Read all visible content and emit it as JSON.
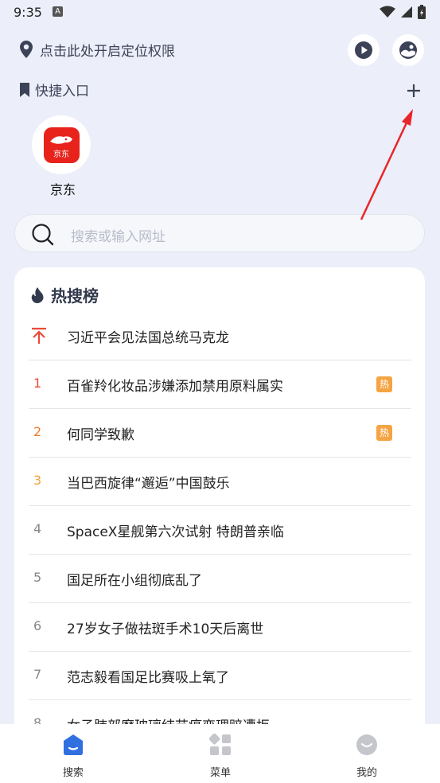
{
  "status_bar": {
    "time": "9:35",
    "notif_letter": "A"
  },
  "location": {
    "text": "点击此处开启定位权限"
  },
  "quick_access": {
    "title": "快捷入口",
    "add_symbol": "+",
    "apps": [
      {
        "name": "京东",
        "icon_text": "京东",
        "color": "#e8231b"
      }
    ]
  },
  "search": {
    "placeholder": "搜索或输入网址"
  },
  "hot": {
    "title": "热搜榜",
    "badge_label": "热",
    "items": [
      {
        "rank": "",
        "text": "习近平会见法国总统马克龙",
        "pinned": true
      },
      {
        "rank": "1",
        "text": "百雀羚化妆品涉嫌添加禁用原料属实",
        "hot": true
      },
      {
        "rank": "2",
        "text": "何同学致歉",
        "hot": true
      },
      {
        "rank": "3",
        "text": "当巴西旋律“邂逅”中国鼓乐"
      },
      {
        "rank": "4",
        "text": "SpaceX星舰第六次试射 特朗普亲临"
      },
      {
        "rank": "5",
        "text": "国足所在小组彻底乱了"
      },
      {
        "rank": "6",
        "text": "27岁女子做祛斑手术10天后离世"
      },
      {
        "rank": "7",
        "text": "范志毅看国足比赛吸上氧了"
      },
      {
        "rank": "8",
        "text": "女子肺部磨玻璃结节癌变理赔遭拒"
      }
    ]
  },
  "bottom_nav": [
    {
      "label": "搜索",
      "active": true
    },
    {
      "label": "菜单"
    },
    {
      "label": "我的"
    }
  ],
  "colors": {
    "accent": "#2f6fe0",
    "background": "#eceef9",
    "annotation_arrow": "#e8262a"
  }
}
